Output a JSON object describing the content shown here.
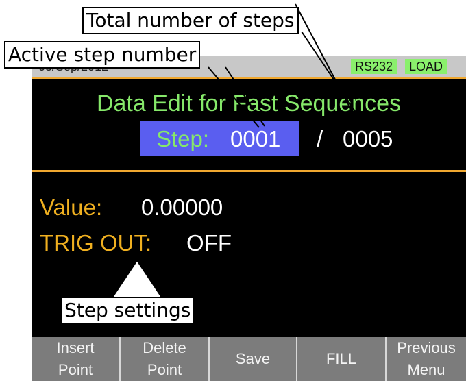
{
  "statusbar": {
    "left_text": "03/Sep/2012",
    "rs232_label": "RS232",
    "load_label": "LOAD"
  },
  "screen": {
    "title": "Data Edit for Fast Sequences",
    "step_label": "Step:",
    "active_step": "0001",
    "separator": "/",
    "total_steps": "0005",
    "value_label": "Value:",
    "value": "0.00000",
    "trig_label": "TRIG OUT:",
    "trig_value": "OFF"
  },
  "softkeys": [
    {
      "line1": "Insert",
      "line2": "Point"
    },
    {
      "line1": "Delete",
      "line2": "Point"
    },
    {
      "line1": "Save",
      "line2": ""
    },
    {
      "line1": "FILL",
      "line2": ""
    },
    {
      "line1": "Previous",
      "line2": "Menu"
    }
  ],
  "callouts": {
    "total": "Total number of steps",
    "active": "Active step number",
    "settings": "Step settings"
  },
  "colors": {
    "title_green": "#86e86a",
    "label_orange": "#f0b020",
    "step_highlight": "#5a5ef0",
    "tag_green": "#8af06c",
    "softkey_gray": "#7c7c7c"
  }
}
